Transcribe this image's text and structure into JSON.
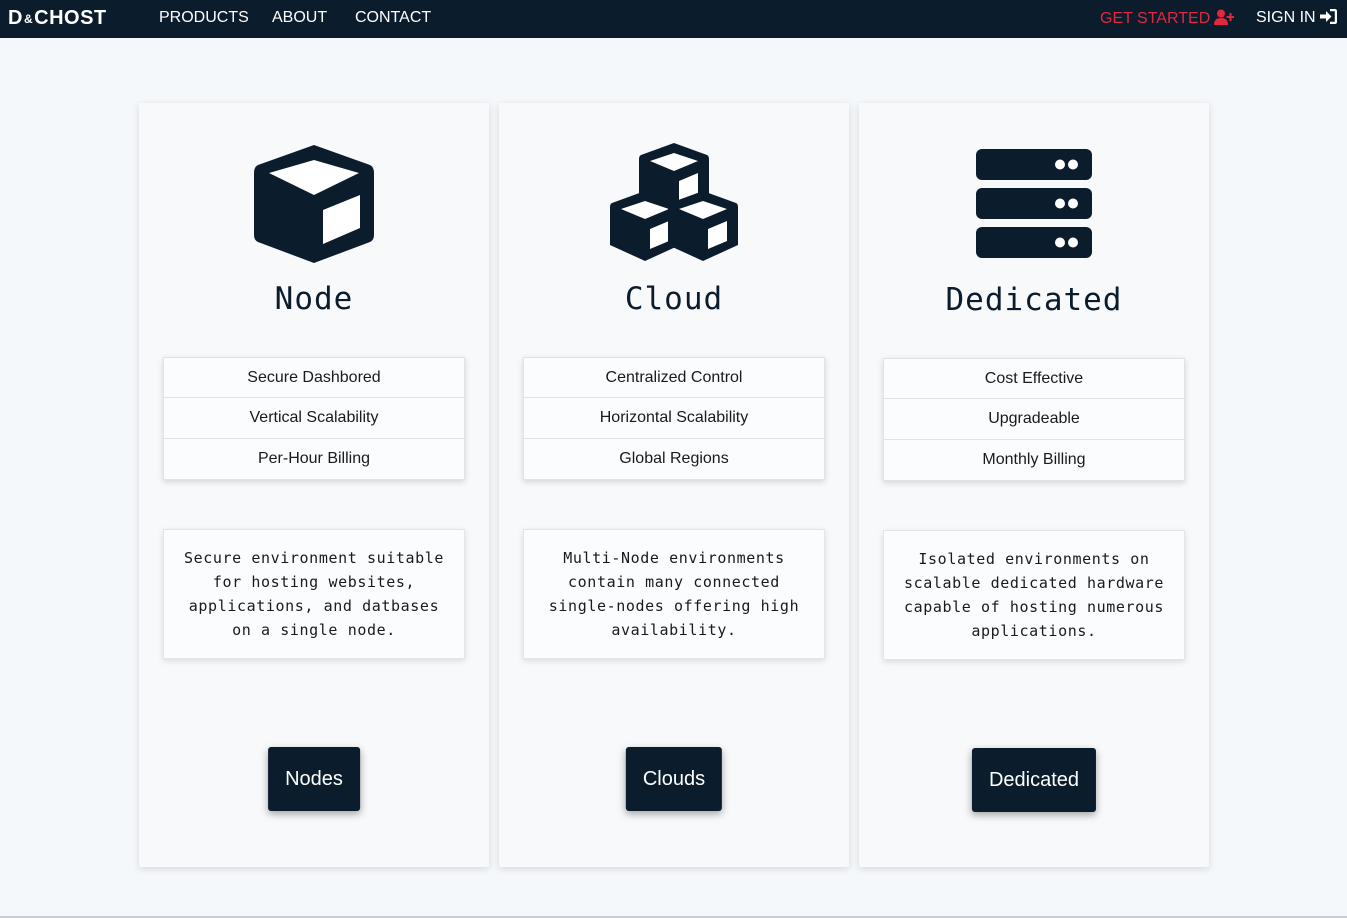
{
  "brand": {
    "left": "D",
    "amp": "&",
    "right": "CHOST"
  },
  "nav": {
    "products": "PRODUCTS",
    "about": "ABOUT",
    "contact": "CONTACT",
    "get_started": "GET STARTED",
    "sign_in": "SIGN IN"
  },
  "colors": {
    "primary": "#0b1c2c",
    "accent": "#e0293f",
    "background": "#f5f8fb"
  },
  "cards": [
    {
      "icon": "cube-icon",
      "title": "Node",
      "features": [
        "Secure Dashbored",
        "Vertical Scalability",
        "Per-Hour Billing"
      ],
      "description": "Secure environment suitable for hosting websites, applications, and datbases on a single node.",
      "button": "Nodes"
    },
    {
      "icon": "cubes-icon",
      "title": "Cloud",
      "features": [
        "Centralized Control",
        "Horizontal Scalability",
        "Global Regions"
      ],
      "description": "Multi-Node environments contain many connected single-nodes offering high availability.",
      "button": "Clouds"
    },
    {
      "icon": "server-icon",
      "title": "Dedicated",
      "features": [
        "Cost Effective",
        "Upgradeable",
        "Monthly Billing"
      ],
      "description": "Isolated environments on scalable dedicated hardware capable of hosting numerous applications.",
      "button": "Dedicated"
    }
  ]
}
